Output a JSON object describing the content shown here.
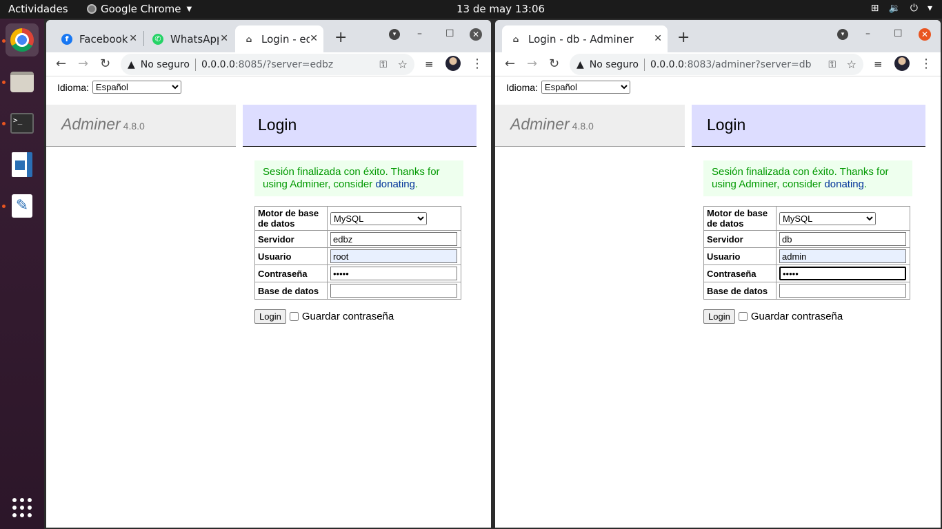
{
  "topbar": {
    "activities": "Actividades",
    "app_name": "Google Chrome",
    "clock": "13 de may  13:06",
    "tray_icons": [
      "network-icon",
      "volume-icon",
      "power-icon",
      "chevron-down-icon"
    ]
  },
  "dock": {
    "items": [
      "chrome",
      "files",
      "terminal",
      "libreoffice-writer",
      "text-editor"
    ],
    "apps_grid": "show-applications-icon"
  },
  "window1": {
    "tabs": [
      {
        "label": "Facebook",
        "icon": "facebook-icon"
      },
      {
        "label": "WhatsApp",
        "icon": "whatsapp-icon"
      },
      {
        "label": "Login - ed",
        "icon": "adminer-icon",
        "active": true
      }
    ],
    "url": {
      "warning": "No seguro",
      "host": "0.0.0.0",
      "rest": ":8085/?server=edbz"
    },
    "page": {
      "language_label": "Idioma:",
      "language_value": "Español",
      "brand": "Adminer",
      "version": "4.8.0",
      "heading": "Login",
      "message_text": "Sesión finalizada con éxito. Thanks for using Adminer, consider",
      "message_link": "donating",
      "message_end": ".",
      "form": {
        "system_label": "Motor de base de datos",
        "system_value": "MySQL",
        "server_label": "Servidor",
        "server_value": "edbz",
        "user_label": "Usuario",
        "user_value": "root",
        "password_label": "Contraseña",
        "password_value": "•••••",
        "database_label": "Base de datos",
        "database_value": ""
      },
      "login_button": "Login",
      "remember_label": "Guardar contraseña"
    }
  },
  "window2": {
    "tabs": [
      {
        "label": "Login - db - Adminer",
        "icon": "adminer-icon",
        "active": true
      }
    ],
    "url": {
      "warning": "No seguro",
      "host": "0.0.0.0",
      "rest": ":8083/adminer?server=db"
    },
    "page": {
      "language_label": "Idioma:",
      "language_value": "Español",
      "brand": "Adminer",
      "version": "4.8.0",
      "heading": "Login",
      "message_text": "Sesión finalizada con éxito. Thanks for using Adminer, consider",
      "message_link": "donating",
      "message_end": ".",
      "form": {
        "system_label": "Motor de base de datos",
        "system_value": "MySQL",
        "server_label": "Servidor",
        "server_value": "db",
        "user_label": "Usuario",
        "user_value": "admin",
        "password_label": "Contraseña",
        "password_value": "•••••",
        "database_label": "Base de datos",
        "database_value": ""
      },
      "login_button": "Login",
      "remember_label": "Guardar contraseña"
    }
  },
  "colors": {
    "close_active": "#e95420",
    "adminer_heading_bg": "#ddddff",
    "message_bg": "#eeffee",
    "message_text": "#009900"
  }
}
